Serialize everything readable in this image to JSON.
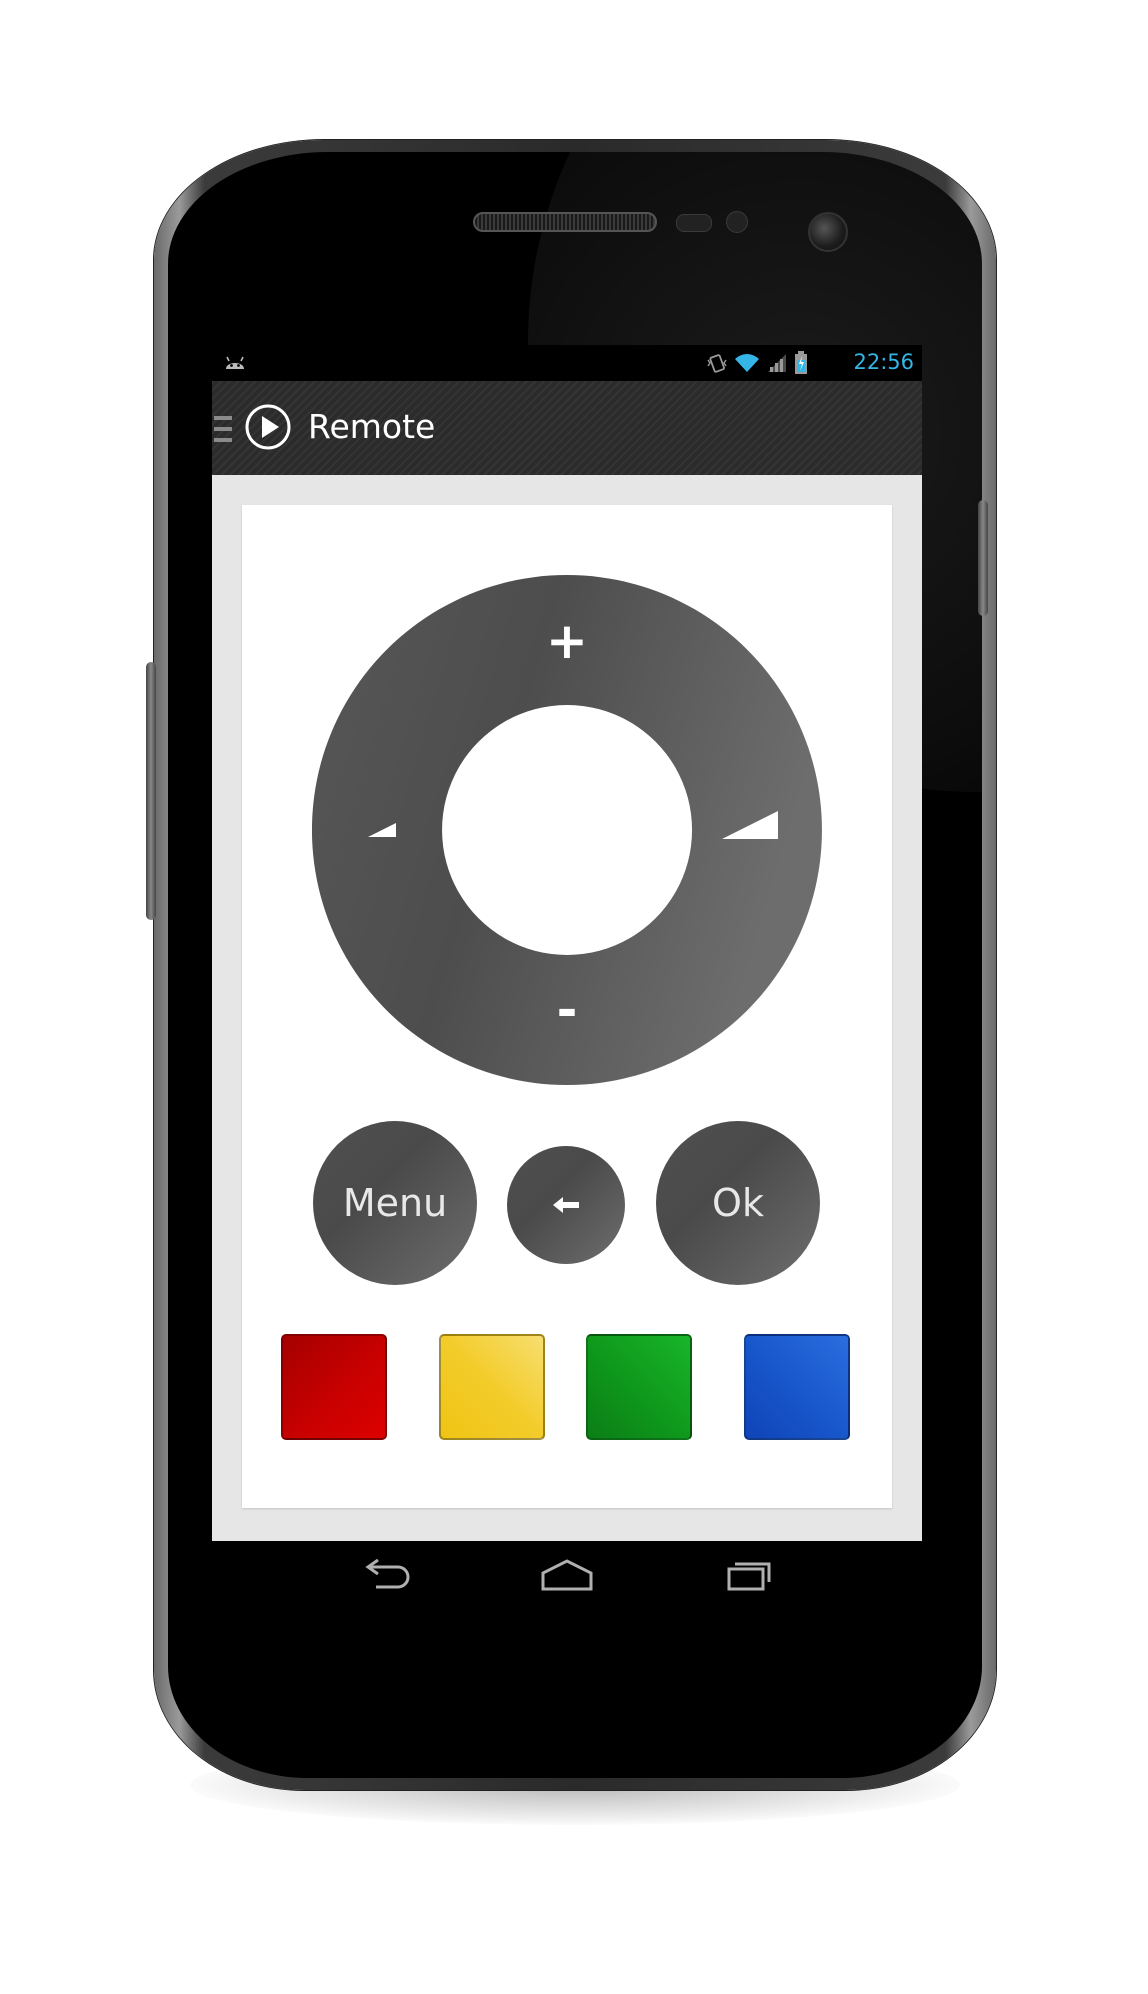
{
  "statusbar": {
    "time": "22:56"
  },
  "actionbar": {
    "title": "Remote"
  },
  "wheel": {
    "up_label": "+",
    "down_label": "-"
  },
  "buttons": {
    "menu_label": "Menu",
    "ok_label": "Ok"
  },
  "colors": {
    "accent": "#35b5e5",
    "red": "#c00000",
    "yellow": "#f2c820",
    "green": "#119a1e",
    "blue": "#1a55cc",
    "control_gray": "#565656"
  },
  "icons": {
    "drawer": "drawer-icon",
    "app": "play-circle-icon",
    "left": "volume-small-icon",
    "right": "volume-large-icon",
    "back": "left-arrow-icon",
    "nav_back": "back-icon",
    "nav_home": "home-icon",
    "nav_recents": "recents-icon"
  }
}
